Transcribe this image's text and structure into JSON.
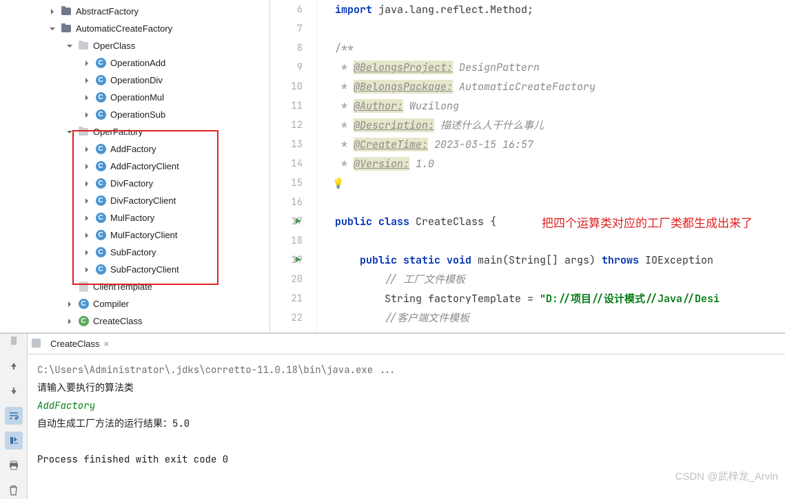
{
  "tree": {
    "items": [
      {
        "indent": 70,
        "arrow": "closed",
        "icon": "folder",
        "label": "AbstractFactory"
      },
      {
        "indent": 70,
        "arrow": "open",
        "icon": "folder",
        "label": "AutomaticCreateFactory"
      },
      {
        "indent": 95,
        "arrow": "open",
        "icon": "folder-light",
        "label": "OperClass"
      },
      {
        "indent": 120,
        "arrow": "closed",
        "icon": "class",
        "label": "OperationAdd"
      },
      {
        "indent": 120,
        "arrow": "closed",
        "icon": "class",
        "label": "OperationDiv"
      },
      {
        "indent": 120,
        "arrow": "closed",
        "icon": "class",
        "label": "OperationMul"
      },
      {
        "indent": 120,
        "arrow": "closed",
        "icon": "class",
        "label": "OperationSub"
      },
      {
        "indent": 95,
        "arrow": "open",
        "icon": "folder-light",
        "label": "OperFactory"
      },
      {
        "indent": 120,
        "arrow": "closed",
        "icon": "class",
        "label": "AddFactory"
      },
      {
        "indent": 120,
        "arrow": "closed",
        "icon": "class",
        "label": "AddFactoryClient"
      },
      {
        "indent": 120,
        "arrow": "closed",
        "icon": "class",
        "label": "DivFactory"
      },
      {
        "indent": 120,
        "arrow": "closed",
        "icon": "class",
        "label": "DivFactoryClient"
      },
      {
        "indent": 120,
        "arrow": "closed",
        "icon": "class",
        "label": "MulFactory"
      },
      {
        "indent": 120,
        "arrow": "closed",
        "icon": "class",
        "label": "MulFactoryClient"
      },
      {
        "indent": 120,
        "arrow": "closed",
        "icon": "class",
        "label": "SubFactory"
      },
      {
        "indent": 120,
        "arrow": "closed",
        "icon": "class",
        "label": "SubFactoryClient"
      },
      {
        "indent": 95,
        "arrow": "none",
        "icon": "file",
        "label": "ClientTemplate"
      },
      {
        "indent": 95,
        "arrow": "closed",
        "icon": "class",
        "label": "Compiler"
      },
      {
        "indent": 95,
        "arrow": "closed",
        "icon": "class-green",
        "label": "CreateClass"
      }
    ]
  },
  "annotation_text": "把四个运算类对应的工厂类都生成出来了",
  "editor": {
    "lines": [
      {
        "num": 6,
        "text_parts": [
          {
            "t": "import ",
            "c": "kw"
          },
          {
            "t": "java.lang.reflect.Method;",
            "c": ""
          }
        ]
      },
      {
        "num": 7,
        "text_parts": []
      },
      {
        "num": 8,
        "text_parts": [
          {
            "t": "/**",
            "c": "javadoc-bl"
          }
        ]
      },
      {
        "num": 9,
        "text_parts": [
          {
            "t": " * ",
            "c": "javadoc-bl"
          },
          {
            "t": "@BelongsProject:",
            "c": "javadoc-tag"
          },
          {
            "t": " DesignPattern",
            "c": "comment"
          }
        ]
      },
      {
        "num": 10,
        "text_parts": [
          {
            "t": " * ",
            "c": "javadoc-bl"
          },
          {
            "t": "@BelongsPackage:",
            "c": "javadoc-tag"
          },
          {
            "t": " AutomaticCreateFactory",
            "c": "comment"
          }
        ]
      },
      {
        "num": 11,
        "text_parts": [
          {
            "t": " * ",
            "c": "javadoc-bl"
          },
          {
            "t": "@Author:",
            "c": "javadoc-tag"
          },
          {
            "t": " Wuzilong",
            "c": "comment"
          }
        ]
      },
      {
        "num": 12,
        "text_parts": [
          {
            "t": " * ",
            "c": "javadoc-bl"
          },
          {
            "t": "@Description:",
            "c": "javadoc-tag"
          },
          {
            "t": " 描述什么人干什么事儿",
            "c": "comment"
          }
        ]
      },
      {
        "num": 13,
        "text_parts": [
          {
            "t": " * ",
            "c": "javadoc-bl"
          },
          {
            "t": "@CreateTime:",
            "c": "javadoc-tag"
          },
          {
            "t": " 2023-03-15 16:57",
            "c": "comment"
          }
        ]
      },
      {
        "num": 14,
        "text_parts": [
          {
            "t": " * ",
            "c": "javadoc-bl"
          },
          {
            "t": "@Version:",
            "c": "javadoc-tag"
          },
          {
            "t": " 1.0",
            "c": "comment"
          }
        ]
      },
      {
        "num": 15,
        "text_parts": [],
        "bulb": true
      },
      {
        "num": 16,
        "text_parts": []
      },
      {
        "num": 17,
        "marker": "run",
        "text_parts": [
          {
            "t": "public class ",
            "c": "kw"
          },
          {
            "t": "CreateClass {",
            "c": ""
          }
        ]
      },
      {
        "num": 18,
        "text_parts": []
      },
      {
        "num": 19,
        "marker": "run",
        "text_parts": [
          {
            "t": "    public static void ",
            "c": "kw"
          },
          {
            "t": "main(String[] args) ",
            "c": ""
          },
          {
            "t": "throws ",
            "c": "kw"
          },
          {
            "t": "IOException",
            "c": ""
          }
        ]
      },
      {
        "num": 20,
        "text_parts": [
          {
            "t": "        // 工厂文件模板",
            "c": "comment"
          }
        ]
      },
      {
        "num": 21,
        "text_parts": [
          {
            "t": "        String factoryTemplate = ",
            "c": ""
          },
          {
            "t": "\"D://项目//设计模式//Java//Desi",
            "c": "str"
          }
        ]
      },
      {
        "num": 22,
        "text_parts": [
          {
            "t": "        //客户端文件模板",
            "c": "comment"
          }
        ]
      }
    ]
  },
  "console": {
    "tab": "CreateClass",
    "lines": [
      {
        "c": "cmd",
        "t": "C:\\Users\\Administrator\\.jdks\\corretto-11.0.18\\bin\\java.exe ..."
      },
      {
        "c": "",
        "t": "请输入要执行的算法类"
      },
      {
        "c": "input-green",
        "t": "AddFactory"
      },
      {
        "c": "",
        "t": "自动生成工厂方法的运行结果：5.0"
      },
      {
        "c": "",
        "t": ""
      },
      {
        "c": "exit",
        "t": "Process finished with exit code 0"
      }
    ]
  },
  "watermark": "CSDN @武梓龙_Arvin"
}
